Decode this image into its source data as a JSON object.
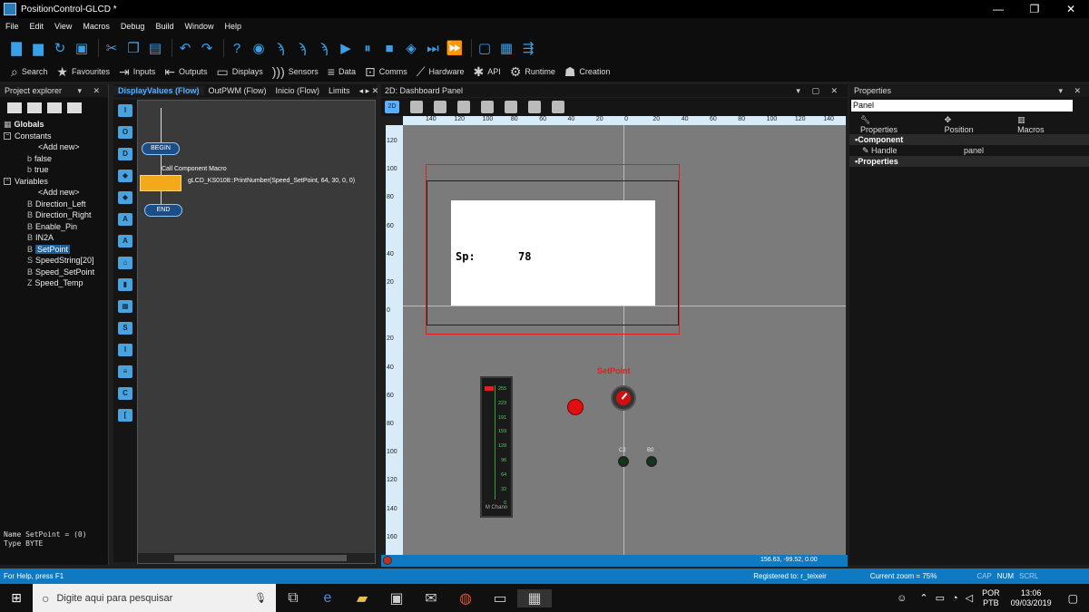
{
  "window": {
    "title": "PositionControl-GLCD *",
    "min": "—",
    "max": "❐",
    "close": "✕"
  },
  "menu": [
    "File",
    "Edit",
    "View",
    "Macros",
    "Debug",
    "Build",
    "Window",
    "Help"
  ],
  "toolbar2": [
    {
      "label": "Search",
      "icon": "search-icon"
    },
    {
      "label": "Favourites",
      "icon": "star-icon"
    },
    {
      "label": "Inputs",
      "icon": "inputs-icon"
    },
    {
      "label": "Outputs",
      "icon": "outputs-icon"
    },
    {
      "label": "Displays",
      "icon": "display-icon"
    },
    {
      "label": "Sensors",
      "icon": "sensor-icon"
    },
    {
      "label": "Data",
      "icon": "data-icon"
    },
    {
      "label": "Comms",
      "icon": "comms-icon"
    },
    {
      "label": "Hardware",
      "icon": "hardware-icon"
    },
    {
      "label": "API",
      "icon": "api-icon"
    },
    {
      "label": "Runtime",
      "icon": "gear-icon"
    },
    {
      "label": "Creation",
      "icon": "creation-icon"
    }
  ],
  "project_explorer": {
    "header": "Project explorer",
    "globals": "Globals",
    "constants": "Constants",
    "constant_items": [
      "<Add new>",
      "false",
      "true"
    ],
    "variables": "Variables",
    "variable_items": [
      "<Add new>",
      "Direction_Left",
      "Direction_Right",
      "Enable_Pin",
      "IN2A",
      "SetPoint",
      "SpeedString[20]",
      "Speed_SetPoint",
      "Speed_Temp"
    ],
    "selected": "SetPoint",
    "info_line1": "Name SetPoint = (0)",
    "info_line2": "Type BYTE"
  },
  "flow_tabs": [
    "DisplayValues (Flow)",
    "OutPWM (Flow)",
    "Inicio (Flow)",
    "Limits"
  ],
  "flow": {
    "begin": "BEGIN",
    "end": "END",
    "macro_title": "Call Component Macro",
    "macro_text": "gLCD_KS0108::PrintNumber(Speed_SetPoint, 64, 30, 0, 0)"
  },
  "dashboard": {
    "header": "2D: Dashboard Panel",
    "mode": "2D",
    "ruler_top": [
      "140",
      "120",
      "100",
      "80",
      "60",
      "40",
      "20",
      "0",
      "20",
      "40",
      "60",
      "80",
      "100",
      "120",
      "140"
    ],
    "ruler_left": [
      "120",
      "100",
      "80",
      "60",
      "40",
      "20",
      "0",
      "20",
      "40",
      "60",
      "80",
      "100",
      "120",
      "140",
      "160"
    ],
    "lcd_label": "Sp:",
    "lcd_value": "78",
    "setpoint_label": "SetPoint",
    "meter_scale": [
      "255",
      "223",
      "191",
      "159",
      "128",
      "96",
      "64",
      "32",
      "0"
    ],
    "meter_caption": "M Chann",
    "led_c2": "C2",
    "led_b0": "B0",
    "coords": "156.63, -99.52, 0.00"
  },
  "properties": {
    "header": "Properties",
    "search": "Panel",
    "tabs": [
      "Properties",
      "Position",
      "Macros"
    ],
    "group_component": "Component",
    "handle_label": "Handle",
    "handle_value": "panel",
    "group_properties": "Properties"
  },
  "statusbar": {
    "help": "For Help, press F1",
    "registered": "Registered to: r_teixeir",
    "zoom": "Current zoom = 75%",
    "cap": "CAP",
    "num": "NUM",
    "scrl": "SCRL"
  },
  "taskbar": {
    "search": "Digite aqui para pesquisar",
    "lang1": "POR",
    "lang2": "PTB",
    "time": "13:06",
    "date": "09/03/2019"
  },
  "colors": {
    "accent": "#0f7ac2",
    "toolbar_icon": "#3aa0e8",
    "setpoint_red": "#e02020"
  }
}
